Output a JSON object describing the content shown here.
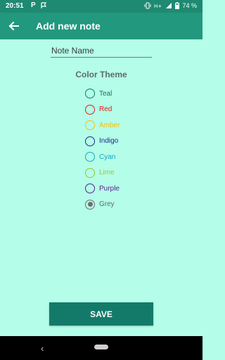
{
  "status_bar": {
    "time": "20:51",
    "p_label": "P",
    "battery_text": "74 %"
  },
  "app_bar": {
    "title": "Add new note"
  },
  "note_name": {
    "placeholder": "Note Name",
    "value": ""
  },
  "color_theme": {
    "title": "Color Theme",
    "options": [
      {
        "label": "Teal",
        "color": "#137a69",
        "label_color": "#2a6b60",
        "selected": false
      },
      {
        "label": "Red",
        "color": "#e21b1b",
        "label_color": "#e21b1b",
        "selected": false
      },
      {
        "label": "Amber",
        "color": "#f2c20d",
        "label_color": "#f2c20d",
        "selected": false
      },
      {
        "label": "Indigo",
        "color": "#1c2c8c",
        "label_color": "#1c2c8c",
        "selected": false
      },
      {
        "label": "Cyan",
        "color": "#15a7c2",
        "label_color": "#15a7c2",
        "selected": false
      },
      {
        "label": "Lime",
        "color": "#9ac827",
        "label_color": "#9ac827",
        "selected": false
      },
      {
        "label": "Purple",
        "color": "#5a1f8d",
        "label_color": "#5a1f8d",
        "selected": false
      },
      {
        "label": "Grey",
        "color": "#6e6e6e",
        "label_color": "#5f6b69",
        "selected": true
      }
    ]
  },
  "save_label": "SAVE",
  "colors": {
    "status_bar": "#1e8a72",
    "app_bar": "#22987e",
    "background": "#b4fde8",
    "save_button": "#137a69"
  }
}
